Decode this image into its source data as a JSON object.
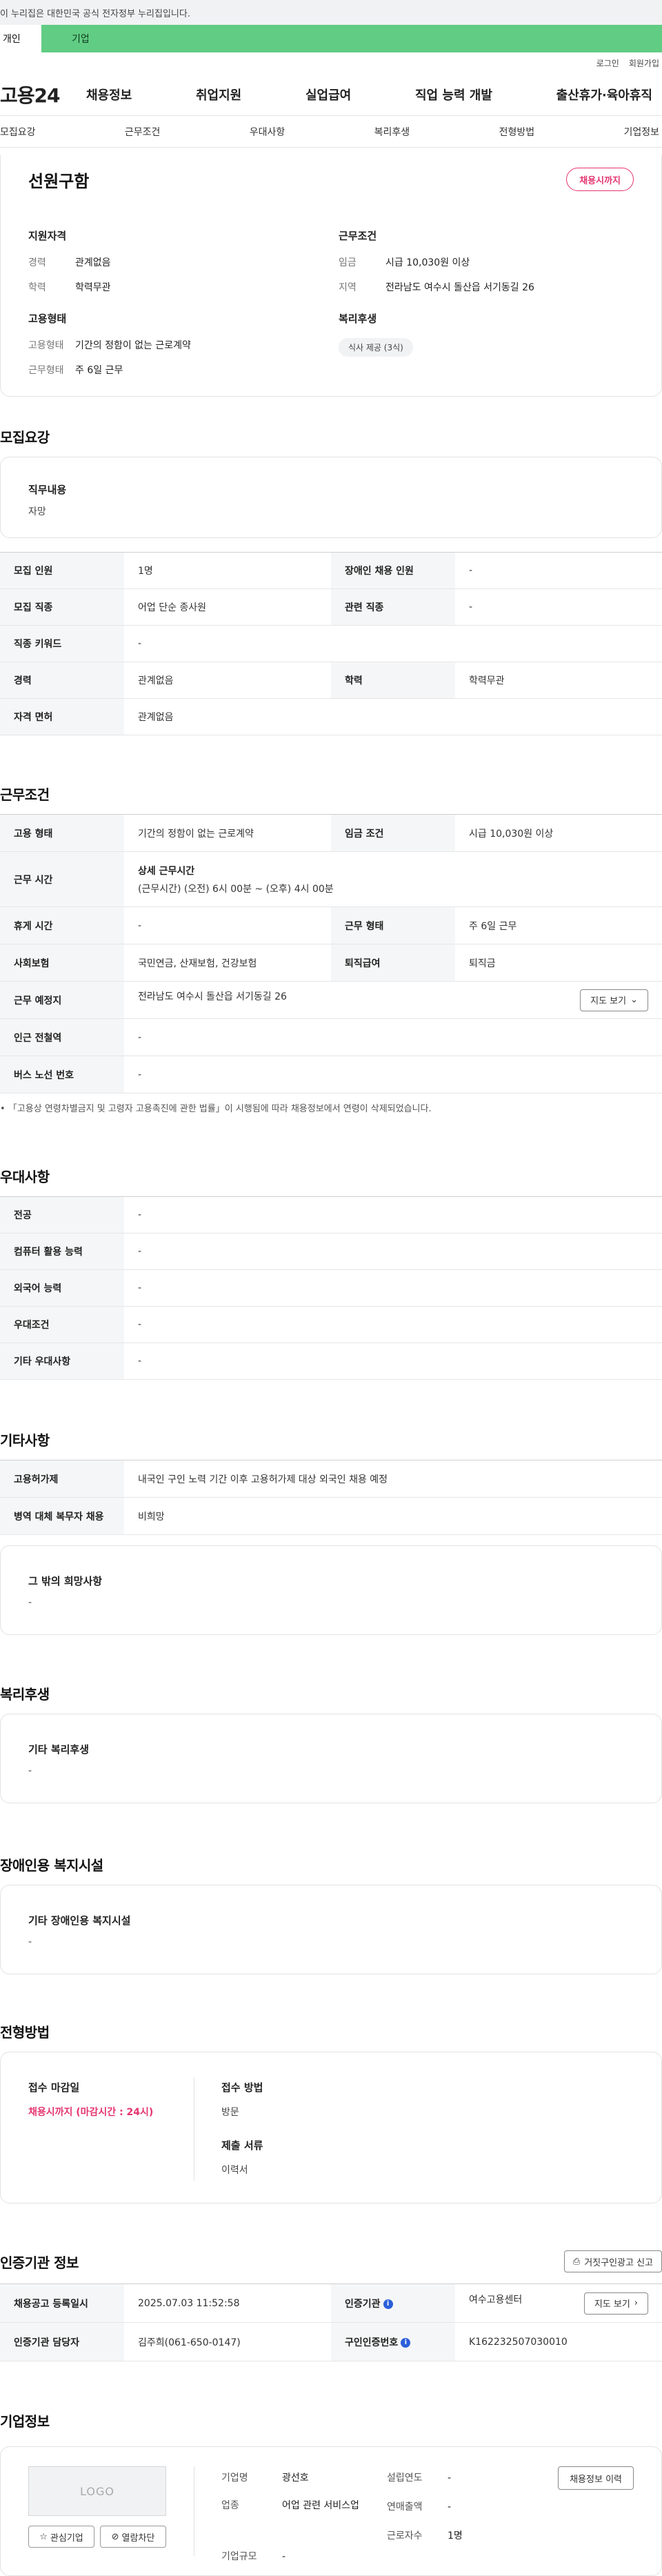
{
  "gov_banner": "이 누리집은 대한민국 공식 전자정부 누리집입니다.",
  "user_tabs": [
    "개인",
    "기업"
  ],
  "top_util": [
    "로그인",
    "회원가입"
  ],
  "logo": "고용24",
  "gnb": [
    "채용정보",
    "취업지원",
    "실업급여",
    "직업 능력 개발",
    "출산휴가·육아휴직"
  ],
  "anchor_nav": [
    "모집요강",
    "근무조건",
    "우대사항",
    "복리후생",
    "전형방법",
    "기업정보"
  ],
  "summary": {
    "title": "선원구함",
    "badge": "채용시까지",
    "qual_head": "지원자격",
    "career_k": "경력",
    "career_v": "관계없음",
    "edu_k": "학력",
    "edu_v": "학력무관",
    "cond_head": "근무조건",
    "wage_k": "임금",
    "wage_v": "시급 10,030원 이상",
    "region_k": "지역",
    "region_v": "전라남도 여수시 돌산읍 서기동길 26",
    "emp_head": "고용형태",
    "emptype_k": "고용형태",
    "emptype_v": "기간의 정함이 없는 근로계약",
    "workform_k": "근무형태",
    "workform_v": "주 6일 근무",
    "welfare_head": "복리후생",
    "welfare_chip": "식사 제공 (3식)"
  },
  "recruit": {
    "title": "모집요강",
    "duty_label": "직무내용",
    "duty_value": "자망",
    "rows": [
      [
        "모집 인원",
        "1명",
        "장애인 채용 인원",
        "-"
      ],
      [
        "모집 직종",
        "어업 단순 종사원",
        "관련 직종",
        "-"
      ],
      [
        "직종 키워드",
        "-"
      ],
      [
        "경력",
        "관계없음",
        "학력",
        "학력무관"
      ],
      [
        "자격 면허",
        "관계없음"
      ]
    ]
  },
  "work": {
    "title": "근무조건",
    "emp_k": "고용 형태",
    "emp_v": "기간의 정함이 없는 근로계약",
    "wage_k": "임금 조건",
    "wage_v": "시급 10,030원 이상",
    "time_k": "근무 시간",
    "time_head": "상세 근무시간",
    "time_v": "(근무시간) (오전) 6시 00분 ~ (오후) 4시 00분",
    "rest_k": "휴게 시간",
    "rest_v": "-",
    "form_k": "근무 형태",
    "form_v": "주 6일 근무",
    "ins_k": "사회보험",
    "ins_v": "국민연금, 산재보험, 건강보험",
    "ret_k": "퇴직급여",
    "ret_v": "퇴직금",
    "place_k": "근무 예정지",
    "place_v": "전라남도 여수시 돌산읍 서기동길 26",
    "map_btn": "지도 보기",
    "subway_k": "인근 전철역",
    "subway_v": "-",
    "bus_k": "버스 노선 번호",
    "bus_v": "-",
    "note": "「고용상 연령차별금지 및 고령자 고용촉진에 관한 법률」이 시행됨에 따라 채용정보에서 연령이 삭제되었습니다."
  },
  "pref": {
    "title": "우대사항",
    "rows": [
      [
        "전공",
        "-"
      ],
      [
        "컴퓨터 활용 능력",
        "-"
      ],
      [
        "외국어 능력",
        "-"
      ],
      [
        "우대조건",
        "-"
      ],
      [
        "기타 우대사항",
        "-"
      ]
    ]
  },
  "etc": {
    "title": "기타사항",
    "rows": [
      [
        "고용허가제",
        "내국인 구인 노력 기간 이후 고용허가제 대상 외국인 채용 예정"
      ],
      [
        "병역 대체 복무자 채용",
        "비희망"
      ]
    ],
    "other_label": "그 밖의 희망사항",
    "other_value": "-"
  },
  "welfare": {
    "title": "복리후생",
    "label": "기타 복리후생",
    "value": "-"
  },
  "disabled": {
    "title": "장애인용 복지시설",
    "label": "기타 장애인용 복지시설",
    "value": "-"
  },
  "selection": {
    "title": "전형방법",
    "deadline_label": "접수 마감일",
    "deadline_value": "채용시까지 (마감시간 : 24시)",
    "method_label": "접수 방법",
    "method_value": "방문",
    "docs_label": "제출 서류",
    "docs_value": "이력서"
  },
  "cert": {
    "title": "인증기관 정보",
    "report_btn": "거짓구인광고 신고",
    "reg_k": "채용공고 등록일시",
    "reg_v": "2025.07.03 11:52:58",
    "org_k": "인증기관",
    "org_v": "여수고용센터",
    "map_btn": "지도 보기",
    "mgr_k": "인증기관 담당자",
    "mgr_v": "김주희(061-650-0147)",
    "id_k": "구인인증번호",
    "id_v": "K162232507030010"
  },
  "company": {
    "title": "기업정보",
    "logo": "LOGO",
    "fav_btn": "관심기업",
    "block_btn": "열람차단",
    "name_k": "기업명",
    "name_v": "광선호",
    "industry_k": "업종",
    "industry_v": "어업 관련 서비스업",
    "size_k": "기업규모",
    "size_v": "-",
    "founded_k": "설립연도",
    "founded_v": "-",
    "sales_k": "연매출액",
    "sales_v": "-",
    "emp_k": "근로자수",
    "emp_v": "1명",
    "history_btn": "채용정보 이력"
  }
}
